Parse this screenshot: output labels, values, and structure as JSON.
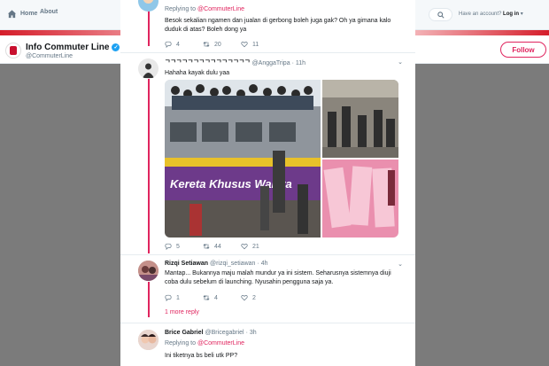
{
  "colors": {
    "accent": "#e0245e",
    "verified": "#1da1f2"
  },
  "topbar": {
    "home_label": "Home",
    "about_label": "About",
    "account_text": "Have an account?",
    "login_label": "Log in"
  },
  "profile": {
    "name": "Info Commuter Line",
    "handle": "@CommuterLine",
    "follow_label": "Follow"
  },
  "tweets": [
    {
      "replying_label": "Replying to",
      "replying_to": "@CommuterLine",
      "text": "Besok sekalian ngamen dan jualan di gerbong boleh juga gak? Oh ya gimana kalo duduk di atas? Boleh dong ya",
      "replies": "4",
      "retweets": "20",
      "likes": "11"
    },
    {
      "name": "ᄀᄀᄀᄀᄀᄀᄀᄀᄀᄀᄀᄀᄀᄀᄀ",
      "handle": "@AnggaTripa",
      "time": "11h",
      "text": "Hahaha kayak dulu yaa",
      "media_sign": "Kereta Khusus Wanita",
      "replies": "5",
      "retweets": "44",
      "likes": "21"
    },
    {
      "name": "Rizqi Setiawan",
      "handle": "@rizqi_setiawan",
      "time": "4h",
      "text": "Mantap... Bukannya maju malah mundur ya ini sistem. Seharusnya sistemnya diuji coba dulu sebelum di launching. Nyusahin pengguna saja ya.",
      "replies": "1",
      "retweets": "4",
      "likes": "2",
      "more_replies": "1 more reply"
    },
    {
      "name": "Brice Gabriel",
      "handle": "@Bricegabriel",
      "time": "3h",
      "replying_label": "Replying to",
      "replying_to": "@CommuterLine",
      "text": "Ini tiketnya bs beli utk PP?"
    }
  ]
}
